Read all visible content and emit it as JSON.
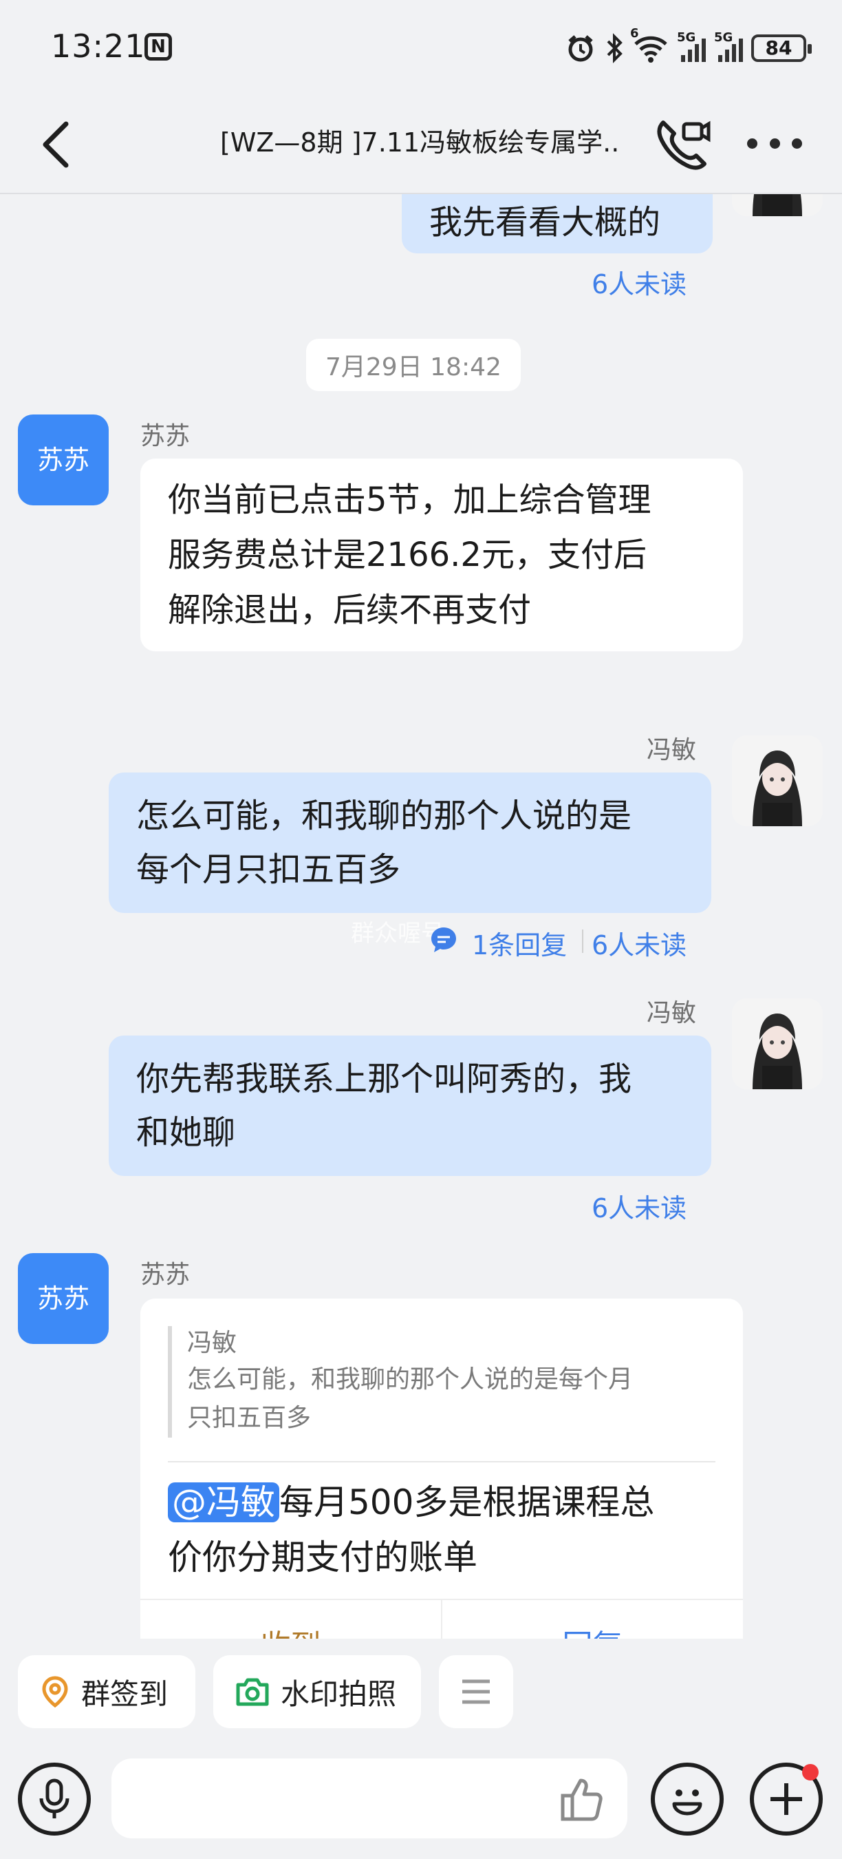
{
  "status_bar": {
    "time": "13:21",
    "nfc": "N",
    "net1": "6",
    "net2": "5G",
    "net3": "5G",
    "battery": "84"
  },
  "header": {
    "title": "[WZ—8期 ]7.11冯敏板绘专属学..."
  },
  "messages": {
    "m1": {
      "text": "我先看看大概的",
      "unread": "6人未读"
    },
    "time_divider": "7月29日 18:42",
    "m2": {
      "sender": "苏苏",
      "avatar_text": "苏苏",
      "lines": [
        "你当前已点击5节，加上综合管理",
        "服务费总计是2166.2元，支付后",
        "解除退出，后续不再支付"
      ]
    },
    "m3": {
      "sender": "冯敏",
      "lines": [
        "怎么可能，和我聊的那个人说的是",
        "每个月只扣五百多"
      ],
      "replies": "1条回复",
      "unread": "6人未读",
      "overlay": "群众喔号"
    },
    "m4": {
      "sender": "冯敏",
      "lines": [
        "你先帮我联系上那个叫阿秀的，我",
        "和她聊"
      ],
      "unread": "6人未读"
    },
    "m5": {
      "sender": "苏苏",
      "avatar_text": "苏苏",
      "quote_name": "冯敏",
      "quote_lines": [
        "怎么可能，和我聊的那个人说的是每个月",
        "只扣五百多"
      ],
      "mention": "@冯敏",
      "text_line1": "每月500多是根据课程总",
      "text_line2": "价你分期支付的账单",
      "action_left": "收到",
      "action_right": "回复"
    }
  },
  "quick_actions": {
    "checkin": "群签到",
    "watermark": "水印拍照"
  },
  "icons": [
    "back-icon",
    "video-call-icon",
    "more-icon",
    "reply-icon",
    "location-pin-icon",
    "camera-icon",
    "menu-icon",
    "microphone-icon",
    "thumbs-up-icon",
    "emoji-icon",
    "plus-icon"
  ]
}
